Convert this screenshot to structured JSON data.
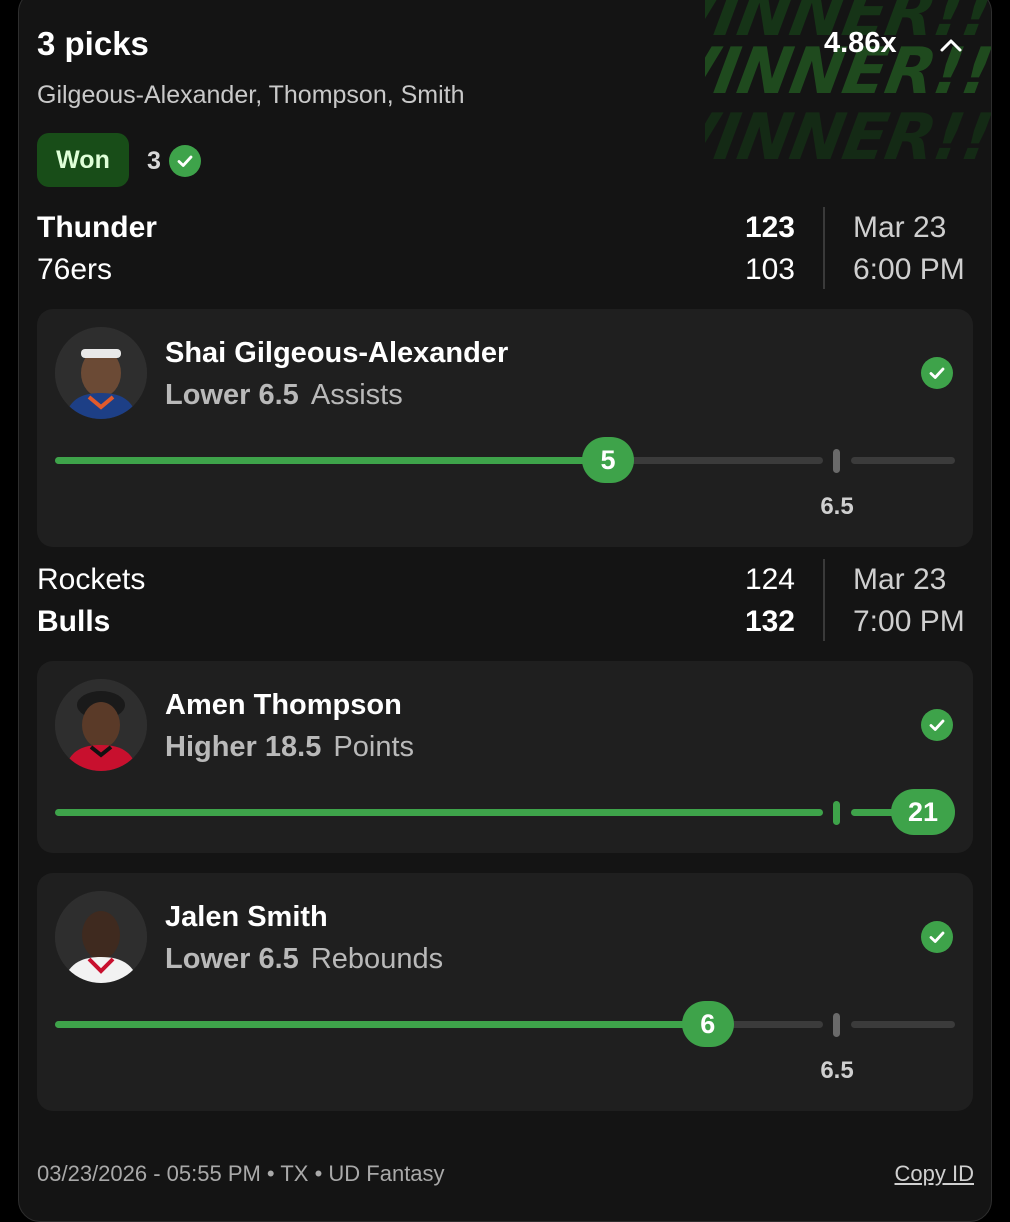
{
  "header": {
    "title": "3 picks",
    "multiplier": "4.86x",
    "players_summary": "Gilgeous-Alexander, Thompson, Smith",
    "status": "Won",
    "won_count": "3",
    "winner_art": [
      "WINNER!!",
      "WINNER!!",
      "WINNER!!"
    ]
  },
  "games": [
    {
      "team_a": "Thunder",
      "score_a": "123",
      "team_b": "76ers",
      "score_b": "103",
      "date": "Mar 23",
      "time": "6:00 PM"
    },
    {
      "team_a": "Rockets",
      "score_a": "124",
      "team_b": "Bulls",
      "score_b": "132",
      "date": "Mar 23",
      "time": "7:00 PM"
    }
  ],
  "picks": [
    {
      "name": "Shai Gilgeous-Alexander",
      "direction": "Lower",
      "line": "6.5",
      "stat": "Assists",
      "result": "5",
      "progress_fraction": 0.72,
      "line_label": "6.5"
    },
    {
      "name": "Amen Thompson",
      "direction": "Higher",
      "line": "18.5",
      "stat": "Points",
      "result": "21",
      "progress_fraction": 1.0
    },
    {
      "name": "Jalen Smith",
      "direction": "Lower",
      "line": "6.5",
      "stat": "Rebounds",
      "result": "6",
      "progress_fraction": 0.85,
      "line_label": "6.5"
    }
  ],
  "footer": {
    "meta": "03/23/2026 - 05:55 PM • TX • UD Fantasy",
    "copy_label": "Copy ID"
  },
  "colors": {
    "accent_green": "#3ea34a",
    "won_badge_bg": "#184d18",
    "card_bg": "#1f1f1f"
  }
}
